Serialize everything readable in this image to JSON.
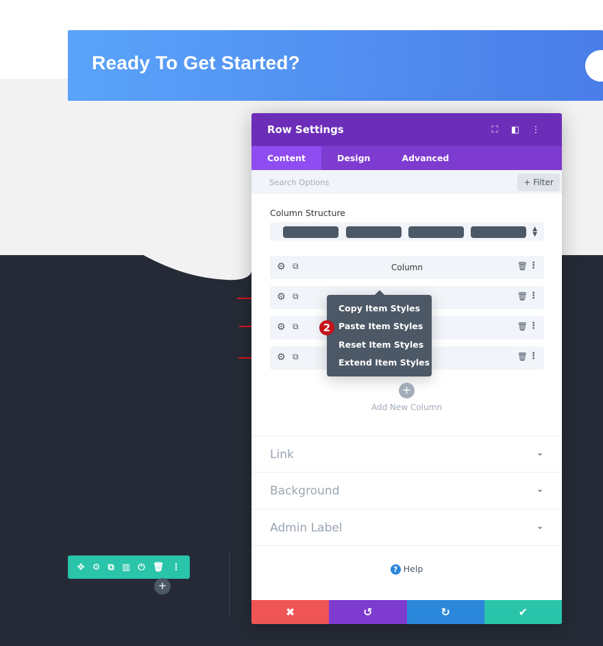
{
  "banner": {
    "title": "Ready To Get Started?"
  },
  "panel": {
    "title": "Row Settings",
    "header_icons": [
      "fullscreen-icon",
      "sidebar-icon",
      "more-icon"
    ],
    "tabs": [
      {
        "label": "Content",
        "active": true
      },
      {
        "label": "Design"
      },
      {
        "label": "Advanced"
      }
    ],
    "search_placeholder": "Search Options",
    "filter_label": "+ Filter",
    "column_structure_label": "Column Structure",
    "columns": [
      {
        "label": "Column"
      },
      {
        "label": ""
      },
      {
        "label": ""
      },
      {
        "label": ""
      }
    ],
    "context_menu": [
      "Copy Item Styles",
      "Paste Item Styles",
      "Reset Item Styles",
      "Extend Item Styles"
    ],
    "step_badge": "2",
    "add_column_label": "Add New Column",
    "sections": [
      {
        "label": "Link"
      },
      {
        "label": "Background"
      },
      {
        "label": "Admin Label"
      }
    ],
    "help_label": "Help"
  },
  "colors": {
    "header": "#6c2eb9",
    "tabs": "#7e3bd0",
    "cancel": "#ef5555",
    "undo": "#7e3bd0",
    "redo": "#2b87da",
    "save": "#29c4a9",
    "row_toolbar": "#29c4a9",
    "annotation": "#d8161b"
  }
}
